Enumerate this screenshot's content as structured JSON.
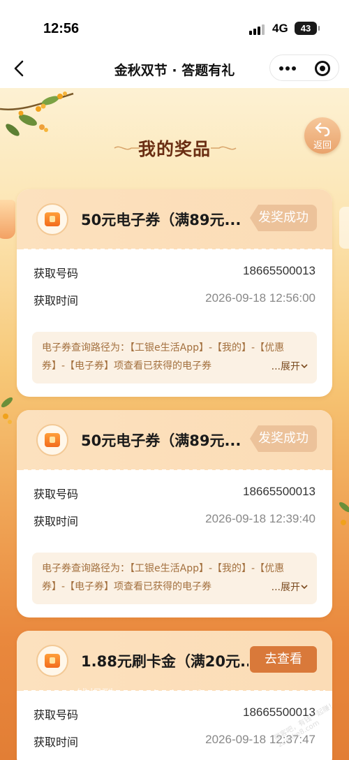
{
  "status_bar": {
    "time": "12:56",
    "network": "4G",
    "battery": "43"
  },
  "nav": {
    "title": "金秋双节 · 答题有礼"
  },
  "page": {
    "heading": "我的奖品",
    "return_label": "返回"
  },
  "cards": [
    {
      "title": "50元电子券（满89元...",
      "status": "发奖成功",
      "rows": [
        {
          "label": "获取号码",
          "value": "18665500013"
        },
        {
          "label": "获取时间",
          "value": "2026-09-18 12:56:00"
        }
      ],
      "note": "电子券查询路径为：【工银e生活App】-【我的】-【优惠券】-【电子券】项查看已获得的电子券",
      "expand": "...展开"
    },
    {
      "title": "50元电子券（满89元...",
      "status": "发奖成功",
      "rows": [
        {
          "label": "获取号码",
          "value": "18665500013"
        },
        {
          "label": "获取时间",
          "value": "2026-09-18 12:39:40"
        }
      ],
      "note": "电子券查询路径为：【工银e生活App】-【我的】-【优惠券】-【电子券】项查看已获得的电子券",
      "expand": "...展开"
    },
    {
      "title": "1.88元刷卡金（满20元...",
      "action": "去查看",
      "rows": [
        {
          "label": "获取号码",
          "value": "18665500013"
        },
        {
          "label": "获取时间",
          "value": "2026-09-18 12:37:47"
        }
      ]
    }
  ],
  "watermark": "线报酷-new.xianbao.fun",
  "watermark_small": "赚客吧，有钱一起赚！ zuanke8.com",
  "icons": {
    "back": "chevron-left-icon",
    "more": "more-dots-icon",
    "close": "target-close-icon",
    "return": "return-arrow-icon",
    "coupon": "coupon-icon",
    "expand": "chevron-down-icon"
  },
  "colors": {
    "badge": "#ecc29a",
    "view_button": "#d9793a",
    "heading": "#6a2e13",
    "note_text": "#a3703e"
  }
}
